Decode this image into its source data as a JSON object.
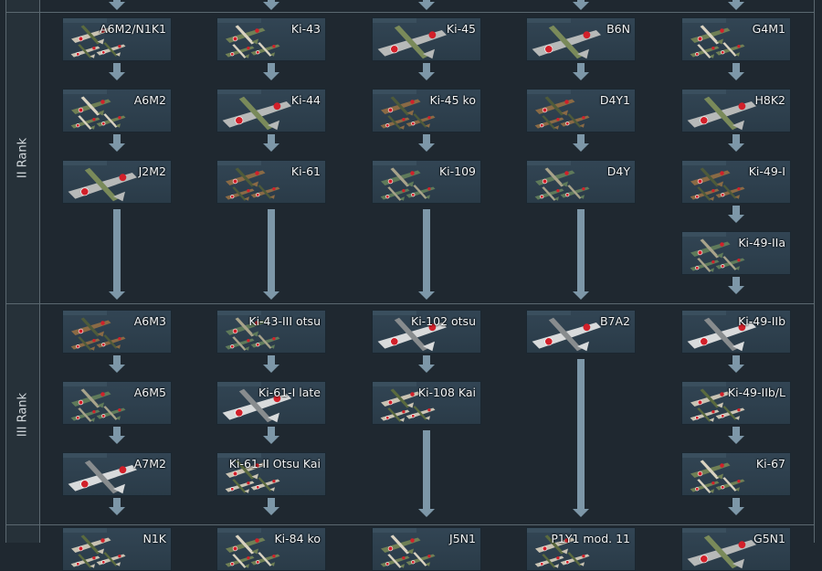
{
  "ranks": [
    {
      "label": "II Rank"
    },
    {
      "label": "III Rank"
    }
  ],
  "colors": {
    "background": "#1f2830",
    "card": "#2f4250",
    "arrow": "#7d97a8",
    "border": "#5b6870",
    "text": "#f2f5f7"
  },
  "columns": [
    {
      "rank2": [
        "A6M2/N1K1",
        "A6M2",
        "J2M2"
      ],
      "rank3": [
        "A6M3",
        "A6M5",
        "A7M2"
      ],
      "rank4": [
        "N1K"
      ]
    },
    {
      "rank2": [
        "Ki-43",
        "Ki-44",
        "Ki-61"
      ],
      "rank3": [
        "Ki-43-III otsu",
        "Ki-61-I late",
        "Ki-61-II Otsu Kai"
      ],
      "rank4": [
        "Ki-84 ko"
      ]
    },
    {
      "rank2": [
        "Ki-45",
        "Ki-45 ko",
        "Ki-109"
      ],
      "rank3": [
        "Ki-102 otsu",
        "Ki-108 Kai"
      ],
      "rank4": [
        "J5N1"
      ]
    },
    {
      "rank2": [
        "B6N",
        "D4Y1",
        "D4Y"
      ],
      "rank3": [
        "B7A2"
      ],
      "rank4": [
        "P1Y1 mod. 11"
      ]
    },
    {
      "rank2": [
        "G4M1",
        "H8K2",
        "Ki-49-I",
        "Ki-49-IIa"
      ],
      "rank3": [
        "Ki-49-IIb",
        "Ki-49-IIb/L",
        "Ki-67"
      ],
      "rank4": [
        "G5N1"
      ]
    }
  ]
}
